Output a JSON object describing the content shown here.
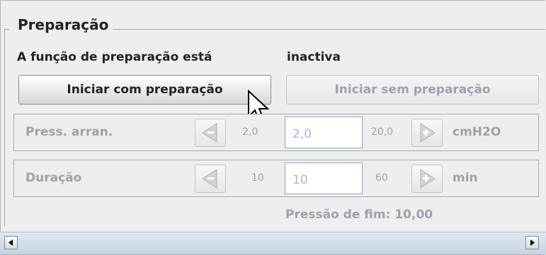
{
  "section": {
    "legend": "Preparação",
    "status_label": "A função de preparação está",
    "status_value": "inactiva"
  },
  "buttons": {
    "start_with_prep": "Iniciar com preparação",
    "start_without_prep": "Iniciar sem preparação"
  },
  "rows": [
    {
      "label": "Press. arran.",
      "min": "2,0",
      "value": "2,0",
      "max": "20,0",
      "unit": "cmH2O"
    },
    {
      "label": "Duração",
      "min": "10",
      "value": "10",
      "max": "60",
      "unit": "min"
    }
  ],
  "footer": {
    "end_pressure": "Pressão de fim: 10,00"
  },
  "icons": [
    "minus-arrow-left-icon",
    "plus-arrow-right-icon",
    "mouse-pointer-icon",
    "scroll-left-icon",
    "scroll-right-icon"
  ],
  "colors": {
    "border_accent": "#8aa9cc",
    "disabled_text": "#9aa3ad"
  }
}
